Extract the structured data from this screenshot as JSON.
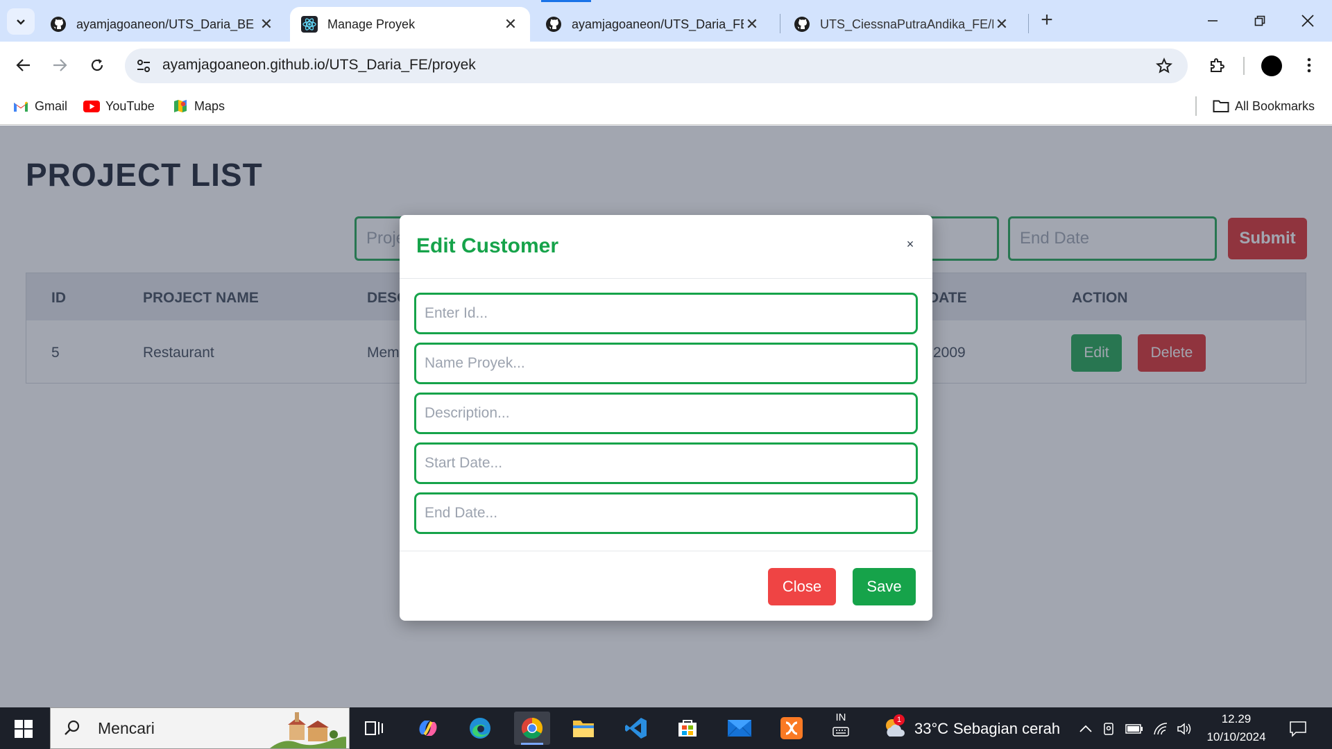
{
  "browser": {
    "tabs": [
      {
        "title": "ayamjagoaneon/UTS_Daria_BE",
        "favicon": "github-icon",
        "active": false
      },
      {
        "title": "Manage Proyek",
        "favicon": "react-icon",
        "active": true
      },
      {
        "title": "ayamjagoaneon/UTS_Daria_FE",
        "favicon": "github-icon",
        "active": false
      },
      {
        "title": "UTS_CiessnaPutraAndika_FE/RE",
        "favicon": "github-icon",
        "active": false
      }
    ],
    "url": "ayamjagoaneon.github.io/UTS_Daria_FE/proyek",
    "bookmarks": [
      {
        "label": "Gmail",
        "icon": "gmail-icon"
      },
      {
        "label": "YouTube",
        "icon": "youtube-icon"
      },
      {
        "label": "Maps",
        "icon": "maps-icon"
      }
    ],
    "all_bookmarks": "All Bookmarks"
  },
  "page": {
    "title": "PROJECT LIST",
    "form": {
      "project_placeholder": "Proje",
      "end_date_placeholder": "End Date",
      "submit_label": "Submit"
    },
    "table": {
      "headers": [
        "ID",
        "PROJECT NAME",
        "DESC",
        "DATE",
        "ACTION"
      ],
      "rows": [
        {
          "id": "5",
          "name": "Restaurant",
          "desc": "Mem",
          "date": "-2009"
        }
      ],
      "edit_label": "Edit",
      "delete_label": "Delete"
    }
  },
  "modal": {
    "title": "Edit Customer",
    "close_symbol": "×",
    "fields": [
      {
        "placeholder": "Enter Id..."
      },
      {
        "placeholder": "Name Proyek..."
      },
      {
        "placeholder": "Description..."
      },
      {
        "placeholder": "Start Date..."
      },
      {
        "placeholder": "End Date..."
      }
    ],
    "close_label": "Close",
    "save_label": "Save"
  },
  "taskbar": {
    "search_text": "Mencari",
    "lang": "IN",
    "weather_temp": "33°C",
    "weather_desc": "Sebagian cerah",
    "weather_badge": "1",
    "time": "12.29",
    "date": "10/10/2024"
  },
  "colors": {
    "primary_green": "#16a34a",
    "danger_red": "#ef4444",
    "chrome_blue": "#d3e3fd"
  }
}
